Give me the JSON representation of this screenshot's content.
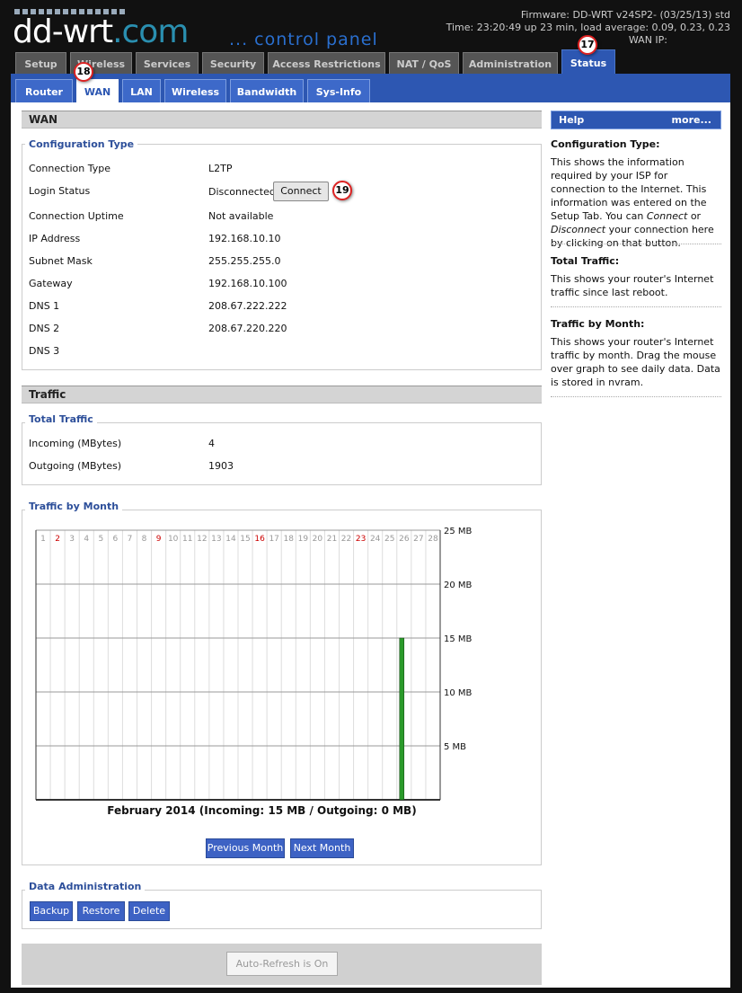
{
  "header": {
    "logo": "dd-wrt",
    "logo_suffix": ".com",
    "tagline": "... control panel",
    "firmware": "Firmware: DD-WRT v24SP2- (03/25/13) std",
    "time": "Time: 23:20:49 up 23 min, load average: 0.09, 0.23, 0.23",
    "wan_ip": "WAN IP:"
  },
  "tabs": [
    "Setup",
    "Wireless",
    "Services",
    "Security",
    "Access Restrictions",
    "NAT / QoS",
    "Administration",
    "Status"
  ],
  "subtabs": [
    "Router",
    "WAN",
    "LAN",
    "Wireless",
    "Bandwidth",
    "Sys-Info"
  ],
  "badges": {
    "status": "17",
    "wan": "18",
    "connect": "19"
  },
  "wan": {
    "title": "WAN",
    "config_legend": "Configuration Type",
    "rows": [
      {
        "label": "Connection Type",
        "value": "L2TP"
      },
      {
        "label": "Login Status",
        "value": "Disconnected"
      },
      {
        "label": "Connection Uptime",
        "value": "Not available"
      },
      {
        "label": "IP Address",
        "value": "192.168.10.10"
      },
      {
        "label": "Subnet Mask",
        "value": "255.255.255.0"
      },
      {
        "label": "Gateway",
        "value": "192.168.10.100"
      },
      {
        "label": "DNS 1",
        "value": "208.67.222.222"
      },
      {
        "label": "DNS 2",
        "value": "208.67.220.220"
      },
      {
        "label": "DNS 3",
        "value": ""
      }
    ],
    "connect_label": "Connect"
  },
  "traffic": {
    "title": "Traffic",
    "total_legend": "Total Traffic",
    "incoming_label": "Incoming (MBytes)",
    "incoming_value": "4",
    "outgoing_label": "Outgoing (MBytes)",
    "outgoing_value": "1903",
    "month_legend": "Traffic by Month",
    "prev_label": "Previous Month",
    "next_label": "Next Month"
  },
  "data_admin": {
    "legend": "Data Administration",
    "backup": "Backup",
    "restore": "Restore",
    "delete": "Delete"
  },
  "autorefresh": "Auto-Refresh is On",
  "help": {
    "title": "Help",
    "more": "more...",
    "sections": [
      {
        "title": "Configuration Type:",
        "text_parts": [
          "This shows the information required by your ISP for connection to the Internet. This information was entered on the Setup Tab. You can ",
          "Connect",
          " or ",
          "Disconnect",
          " your connection here by clicking on that button."
        ]
      },
      {
        "title": "Total Traffic:",
        "text": "This shows your router's Internet traffic since last reboot."
      },
      {
        "title": "Traffic by Month:",
        "text": "This shows your router's Internet traffic by month. Drag the mouse over graph to see daily data. Data is stored in nvram."
      }
    ]
  },
  "chart_data": {
    "type": "bar",
    "title": "February 2014 (Incoming: 15 MB / Outgoing: 0 MB)",
    "categories": [
      "1",
      "2",
      "3",
      "4",
      "5",
      "6",
      "7",
      "8",
      "9",
      "10",
      "11",
      "12",
      "13",
      "14",
      "15",
      "16",
      "17",
      "18",
      "19",
      "20",
      "21",
      "22",
      "23",
      "24",
      "25",
      "26",
      "27",
      "28"
    ],
    "weekend_days": [
      "2",
      "9",
      "16",
      "23"
    ],
    "series": [
      {
        "name": "Incoming",
        "color": "#2a9a2a",
        "values": [
          0,
          0,
          0,
          0,
          0,
          0,
          0,
          0,
          0,
          0,
          0,
          0,
          0,
          0,
          0,
          0,
          0,
          0,
          0,
          0,
          0,
          0,
          0,
          0,
          0,
          15,
          0,
          0
        ]
      },
      {
        "name": "Outgoing",
        "color": "#cc2222",
        "values": [
          0,
          0,
          0,
          0,
          0,
          0,
          0,
          0,
          0,
          0,
          0,
          0,
          0,
          0,
          0,
          0,
          0,
          0,
          0,
          0,
          0,
          0,
          0,
          0,
          0,
          0,
          0,
          0
        ]
      }
    ],
    "ytick_labels": [
      "25 MB",
      "20 MB",
      "15 MB",
      "10 MB",
      "5 MB"
    ],
    "yticks": [
      25,
      20,
      15,
      10,
      5
    ],
    "ylim": [
      0,
      25
    ],
    "grid": true
  }
}
